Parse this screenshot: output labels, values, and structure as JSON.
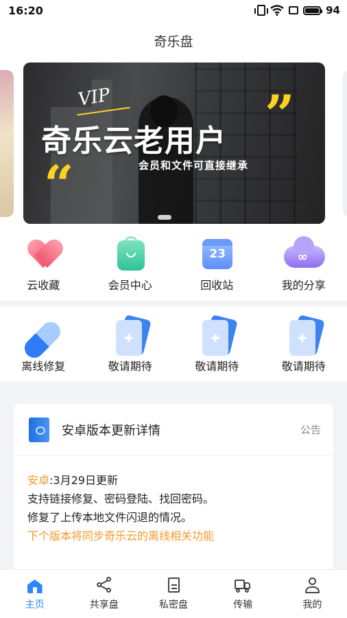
{
  "status_bar": {
    "time": "16:20",
    "battery": "94"
  },
  "header": {
    "title": "奇乐盘"
  },
  "banner": {
    "badge": "VIP",
    "title": "奇乐云老用户",
    "subtitle": "会员和文件可直接继承"
  },
  "quick_actions": [
    {
      "label": "云收藏",
      "icon": "heart-icon"
    },
    {
      "label": "会员中心",
      "icon": "member-bag-icon"
    },
    {
      "label": "回收站",
      "icon": "calendar-icon",
      "icon_text": "23"
    },
    {
      "label": "我的分享",
      "icon": "cloud-share-icon",
      "icon_text": "∞"
    }
  ],
  "more_actions": [
    {
      "label": "离线修复",
      "icon": "capsule-icon"
    },
    {
      "label": "敬请期待",
      "icon": "placeholder-card-icon"
    },
    {
      "label": "敬请期待",
      "icon": "placeholder-card-icon"
    },
    {
      "label": "敬请期待",
      "icon": "placeholder-card-icon"
    }
  ],
  "notice": {
    "title": "安卓版本更新详情",
    "tag": "公告",
    "platform": "安卓",
    "date_line": ":3月29日更新",
    "line1": "支持链接修复、密码登陆、找回密码。",
    "line2": "修复了上传本地文件闪退的情况。",
    "highlight": "下个版本将同步奇乐云的离线相关功能"
  },
  "bottom_nav": [
    {
      "label": "主页",
      "icon": "home-icon",
      "active": true
    },
    {
      "label": "共享盘",
      "icon": "share-icon"
    },
    {
      "label": "私密盘",
      "icon": "document-icon"
    },
    {
      "label": "传输",
      "icon": "truck-icon"
    },
    {
      "label": "我的",
      "icon": "user-icon"
    }
  ],
  "colors": {
    "accent": "#2f86f6",
    "highlight": "#f39a2b",
    "quote": "#ffd21f"
  }
}
